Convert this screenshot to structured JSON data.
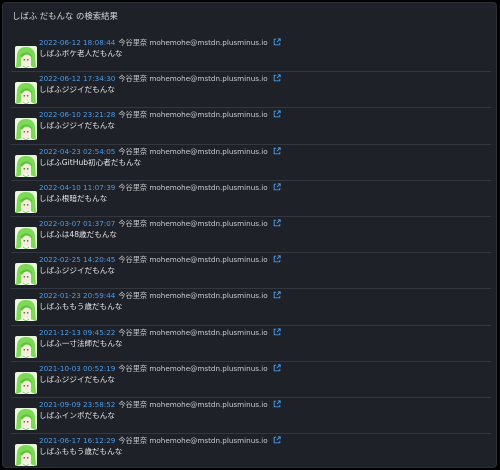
{
  "header": {
    "title": "しばふ だもんな の検索結果"
  },
  "colors": {
    "background": "#1e2127",
    "link": "#4a9be9",
    "text": "#e4e6ea",
    "avatar_green": "#7ed957"
  },
  "results": [
    {
      "date": "2022-06-12 18:08:44",
      "author": "今谷里奈 mohemohe@mstdn.plusminus.io",
      "text": "しばふボケ老人だもんな"
    },
    {
      "date": "2022-06-12 17:34:30",
      "author": "今谷里奈 mohemohe@mstdn.plusminus.io",
      "text": "しばふジジイだもんな"
    },
    {
      "date": "2022-06-10 23:21:28",
      "author": "今谷里奈 mohemohe@mstdn.plusminus.io",
      "text": "しばふジジイだもんな"
    },
    {
      "date": "2022-04-23 02:54:05",
      "author": "今谷里奈 mohemohe@mstdn.plusminus.io",
      "text": "しばふGitHub初心者だもんな"
    },
    {
      "date": "2022-04-10 11:07:39",
      "author": "今谷里奈 mohemohe@mstdn.plusminus.io",
      "text": "しばふ根暗だもんな"
    },
    {
      "date": "2022-03-07 01:37:07",
      "author": "今谷里奈 mohemohe@mstdn.plusminus.io",
      "text": "しばふは48歳だもんな"
    },
    {
      "date": "2022-02-25 14:20:45",
      "author": "今谷里奈 mohemohe@mstdn.plusminus.io",
      "text": "しばふジジイだもんな"
    },
    {
      "date": "2022-01-23 20:59:44",
      "author": "今谷里奈 mohemohe@mstdn.plusminus.io",
      "text": "しばふももう歳だもんな"
    },
    {
      "date": "2021-12-13 09:45:22",
      "author": "今谷里奈 mohemohe@mstdn.plusminus.io",
      "text": "しばふ一寸法師だもんな"
    },
    {
      "date": "2021-10-03 00:52:19",
      "author": "今谷里奈 mohemohe@mstdn.plusminus.io",
      "text": "しばふジジイだもんな"
    },
    {
      "date": "2021-09-09 23:58:52",
      "author": "今谷里奈 mohemohe@mstdn.plusminus.io",
      "text": "しばふインポだもんな"
    },
    {
      "date": "2021-06-17 16:12:29",
      "author": "今谷里奈 mohemohe@mstdn.plusminus.io",
      "text": "しばふももう歳だもんな"
    }
  ]
}
